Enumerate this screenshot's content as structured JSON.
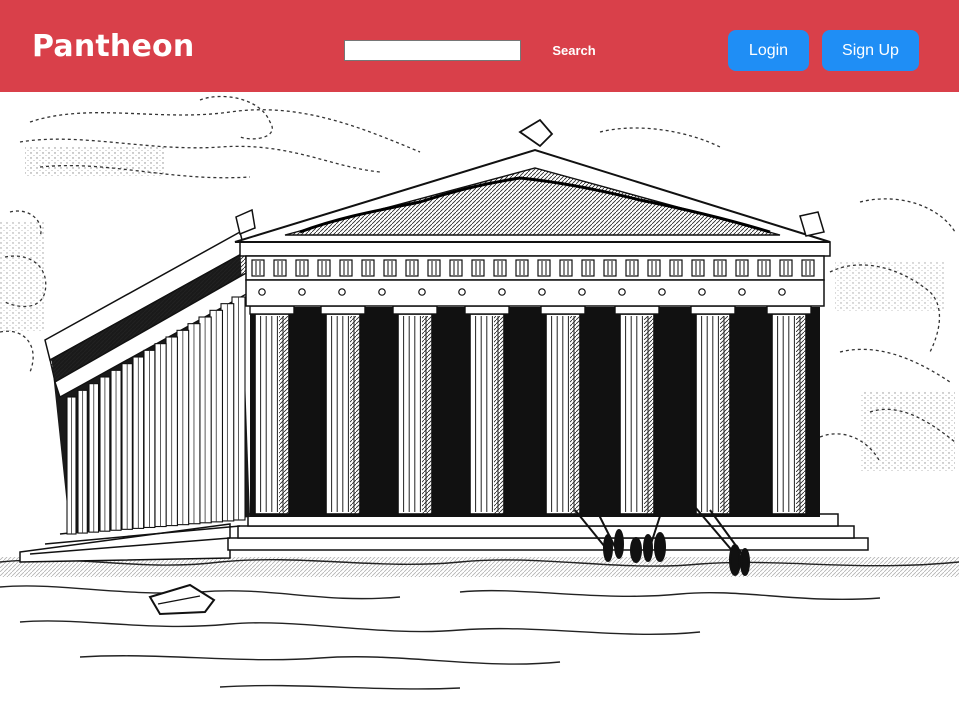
{
  "header": {
    "brand": "Pantheon",
    "search": {
      "value": "",
      "button_label": "Search"
    },
    "login_label": "Login",
    "signup_label": "Sign Up",
    "colors": {
      "header_bg": "#d9404a",
      "button_bg": "#1f8ef5"
    }
  },
  "hero": {
    "image": "parthenon-engraving"
  }
}
